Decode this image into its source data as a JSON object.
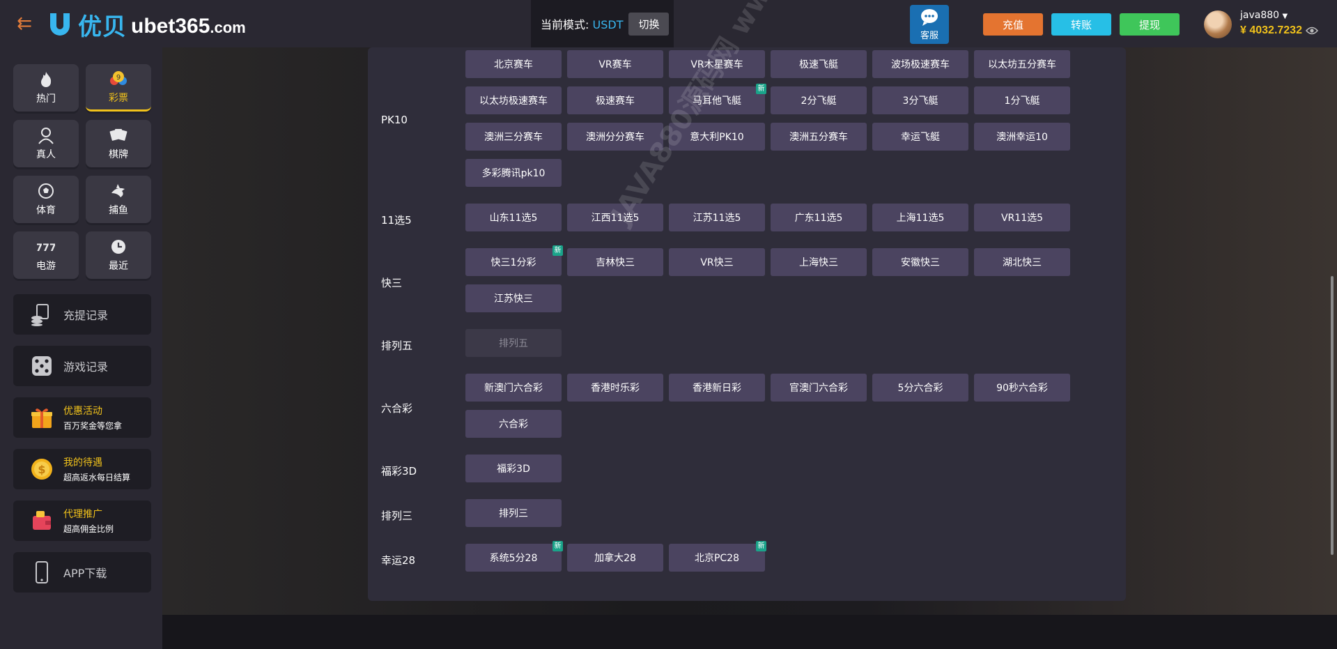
{
  "header": {
    "logo_cn": "优贝",
    "logo_en": "ubet365",
    "logo_tld": ".com",
    "mode_label": "当前模式:",
    "mode_value": "USDT",
    "switch_label": "切换",
    "cs_label": "客服",
    "recharge_label": "充值",
    "transfer_label": "转账",
    "withdraw_label": "提现",
    "username": "java880",
    "balance": "¥ 4032.7232"
  },
  "colors": {
    "accent_gold": "#f1c21b",
    "recharge": "#e47430",
    "transfer": "#27bfe6",
    "withdraw": "#3fc65a",
    "badge_new": "#1aa48a"
  },
  "sidebar": {
    "categories": [
      {
        "label": "热门",
        "icon": "flame-icon"
      },
      {
        "label": "彩票",
        "icon": "lottery-ball-icon",
        "active": true
      },
      {
        "label": "真人",
        "icon": "dealer-icon"
      },
      {
        "label": "棋牌",
        "icon": "cards-icon"
      },
      {
        "label": "体育",
        "icon": "soccer-ball-icon"
      },
      {
        "label": "捕鱼",
        "icon": "shark-icon"
      },
      {
        "label": "电游",
        "icon": "slot-777-icon"
      },
      {
        "label": "最近",
        "icon": "clock-icon"
      }
    ],
    "records": [
      {
        "label": "充提记录",
        "icon": "coins-stack-icon"
      },
      {
        "label": "游戏记录",
        "icon": "dice-icon"
      }
    ],
    "promos": [
      {
        "title": "优惠活动",
        "sub": "百万奖金等您拿",
        "icon": "gift-icon"
      },
      {
        "title": "我的待遇",
        "sub": "超高返水每日结算",
        "icon": "coin-icon"
      },
      {
        "title": "代理推广",
        "sub": "超高佣金比例",
        "icon": "wallet-icon"
      }
    ],
    "app_label": "APP下载"
  },
  "lottery_groups": [
    {
      "name": "PK10",
      "games": [
        "北京赛车",
        "VR赛车",
        "VR木星赛车",
        "极速飞艇",
        "波场极速赛车",
        "以太坊五分赛车",
        "以太坊极速赛车",
        "极速赛车",
        "马耳他飞艇",
        "2分飞艇",
        "3分飞艇",
        "1分飞艇",
        "澳洲三分赛车",
        "澳洲分分赛车",
        "意大利PK10",
        "澳洲五分赛车",
        "幸运飞艇",
        "澳洲幸运10",
        "多彩腾讯pk10"
      ],
      "new": [
        8
      ]
    },
    {
      "name": "11选5",
      "games": [
        "山东11选5",
        "江西11选5",
        "江苏11选5",
        "广东11选5",
        "上海11选5",
        "VR11选5"
      ],
      "new": []
    },
    {
      "name": "快三",
      "games": [
        "快三1分彩",
        "吉林快三",
        "VR快三",
        "上海快三",
        "安徽快三",
        "湖北快三",
        "江苏快三"
      ],
      "new": [
        0
      ]
    },
    {
      "name": "排列五",
      "games": [
        "排列五"
      ],
      "new": [],
      "disabled": true
    },
    {
      "name": "六合彩",
      "games": [
        "新澳门六合彩",
        "香港时乐彩",
        "香港新日彩",
        "官澳门六合彩",
        "5分六合彩",
        "90秒六合彩",
        "六合彩"
      ],
      "new": []
    },
    {
      "name": "福彩3D",
      "games": [
        "福彩3D"
      ],
      "new": []
    },
    {
      "name": "排列三",
      "games": [
        "排列三"
      ],
      "new": []
    },
    {
      "name": "幸运28",
      "games": [
        "系统5分28",
        "加拿大28",
        "北京PC28"
      ],
      "new": [
        0,
        2
      ]
    }
  ],
  "new_badge_text": "新",
  "watermark": "JAVA880源码网 www.java880.com"
}
